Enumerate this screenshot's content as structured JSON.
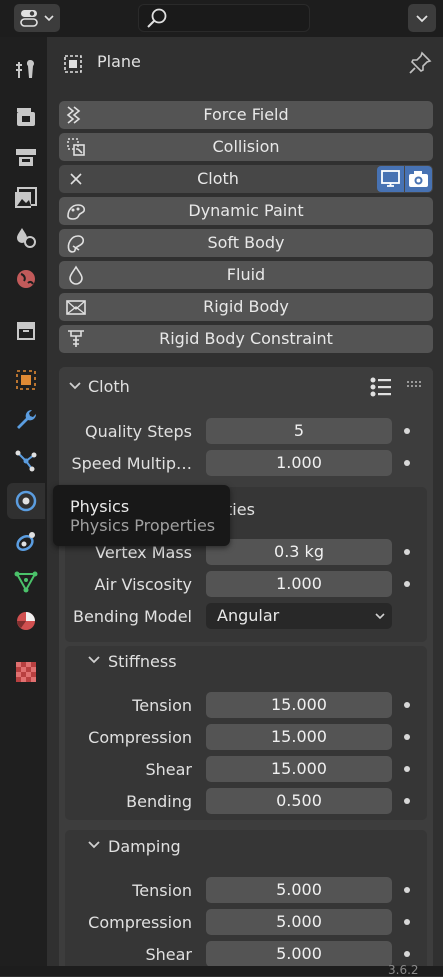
{
  "header": {
    "search_placeholder": ""
  },
  "context": {
    "object_name": "Plane"
  },
  "physics_buttons": [
    {
      "label": "Force Field",
      "icon": "force-field-icon"
    },
    {
      "label": "Collision",
      "icon": "collision-icon"
    },
    {
      "label": "Cloth",
      "icon": "close-icon"
    },
    {
      "label": "Dynamic Paint",
      "icon": "dynamic-paint-icon"
    },
    {
      "label": "Soft Body",
      "icon": "soft-body-icon"
    },
    {
      "label": "Fluid",
      "icon": "fluid-icon"
    },
    {
      "label": "Rigid Body",
      "icon": "rigid-body-icon"
    },
    {
      "label": "Rigid Body Constraint",
      "icon": "rigid-body-constraint-icon"
    }
  ],
  "cloth": {
    "title": "Cloth",
    "quality_steps": {
      "label": "Quality Steps",
      "value": "5"
    },
    "speed_multiplier": {
      "label": "Speed Multip…",
      "value": "1.000"
    }
  },
  "physical_properties": {
    "title_fragment": "ties",
    "vertex_mass": {
      "label": "Vertex Mass",
      "value": "0.3 kg"
    },
    "air_viscosity": {
      "label": "Air Viscosity",
      "value": "1.000"
    },
    "bending_model": {
      "label": "Bending Model",
      "value": "Angular"
    }
  },
  "stiffness": {
    "title": "Stiffness",
    "tension": {
      "label": "Tension",
      "value": "15.000"
    },
    "compression": {
      "label": "Compression",
      "value": "15.000"
    },
    "shear": {
      "label": "Shear",
      "value": "15.000"
    },
    "bending": {
      "label": "Bending",
      "value": "0.500"
    }
  },
  "damping": {
    "title": "Damping",
    "tension": {
      "label": "Tension",
      "value": "5.000"
    },
    "compression": {
      "label": "Compression",
      "value": "5.000"
    },
    "shear": {
      "label": "Shear",
      "value": "5.000"
    }
  },
  "tooltip": {
    "title": "Physics",
    "subtitle": "Physics Properties"
  },
  "version": "3.6.2",
  "colors": {
    "accent": "#4772b3",
    "panel": "#3d3d3d",
    "field": "#545454",
    "background": "#303030"
  }
}
